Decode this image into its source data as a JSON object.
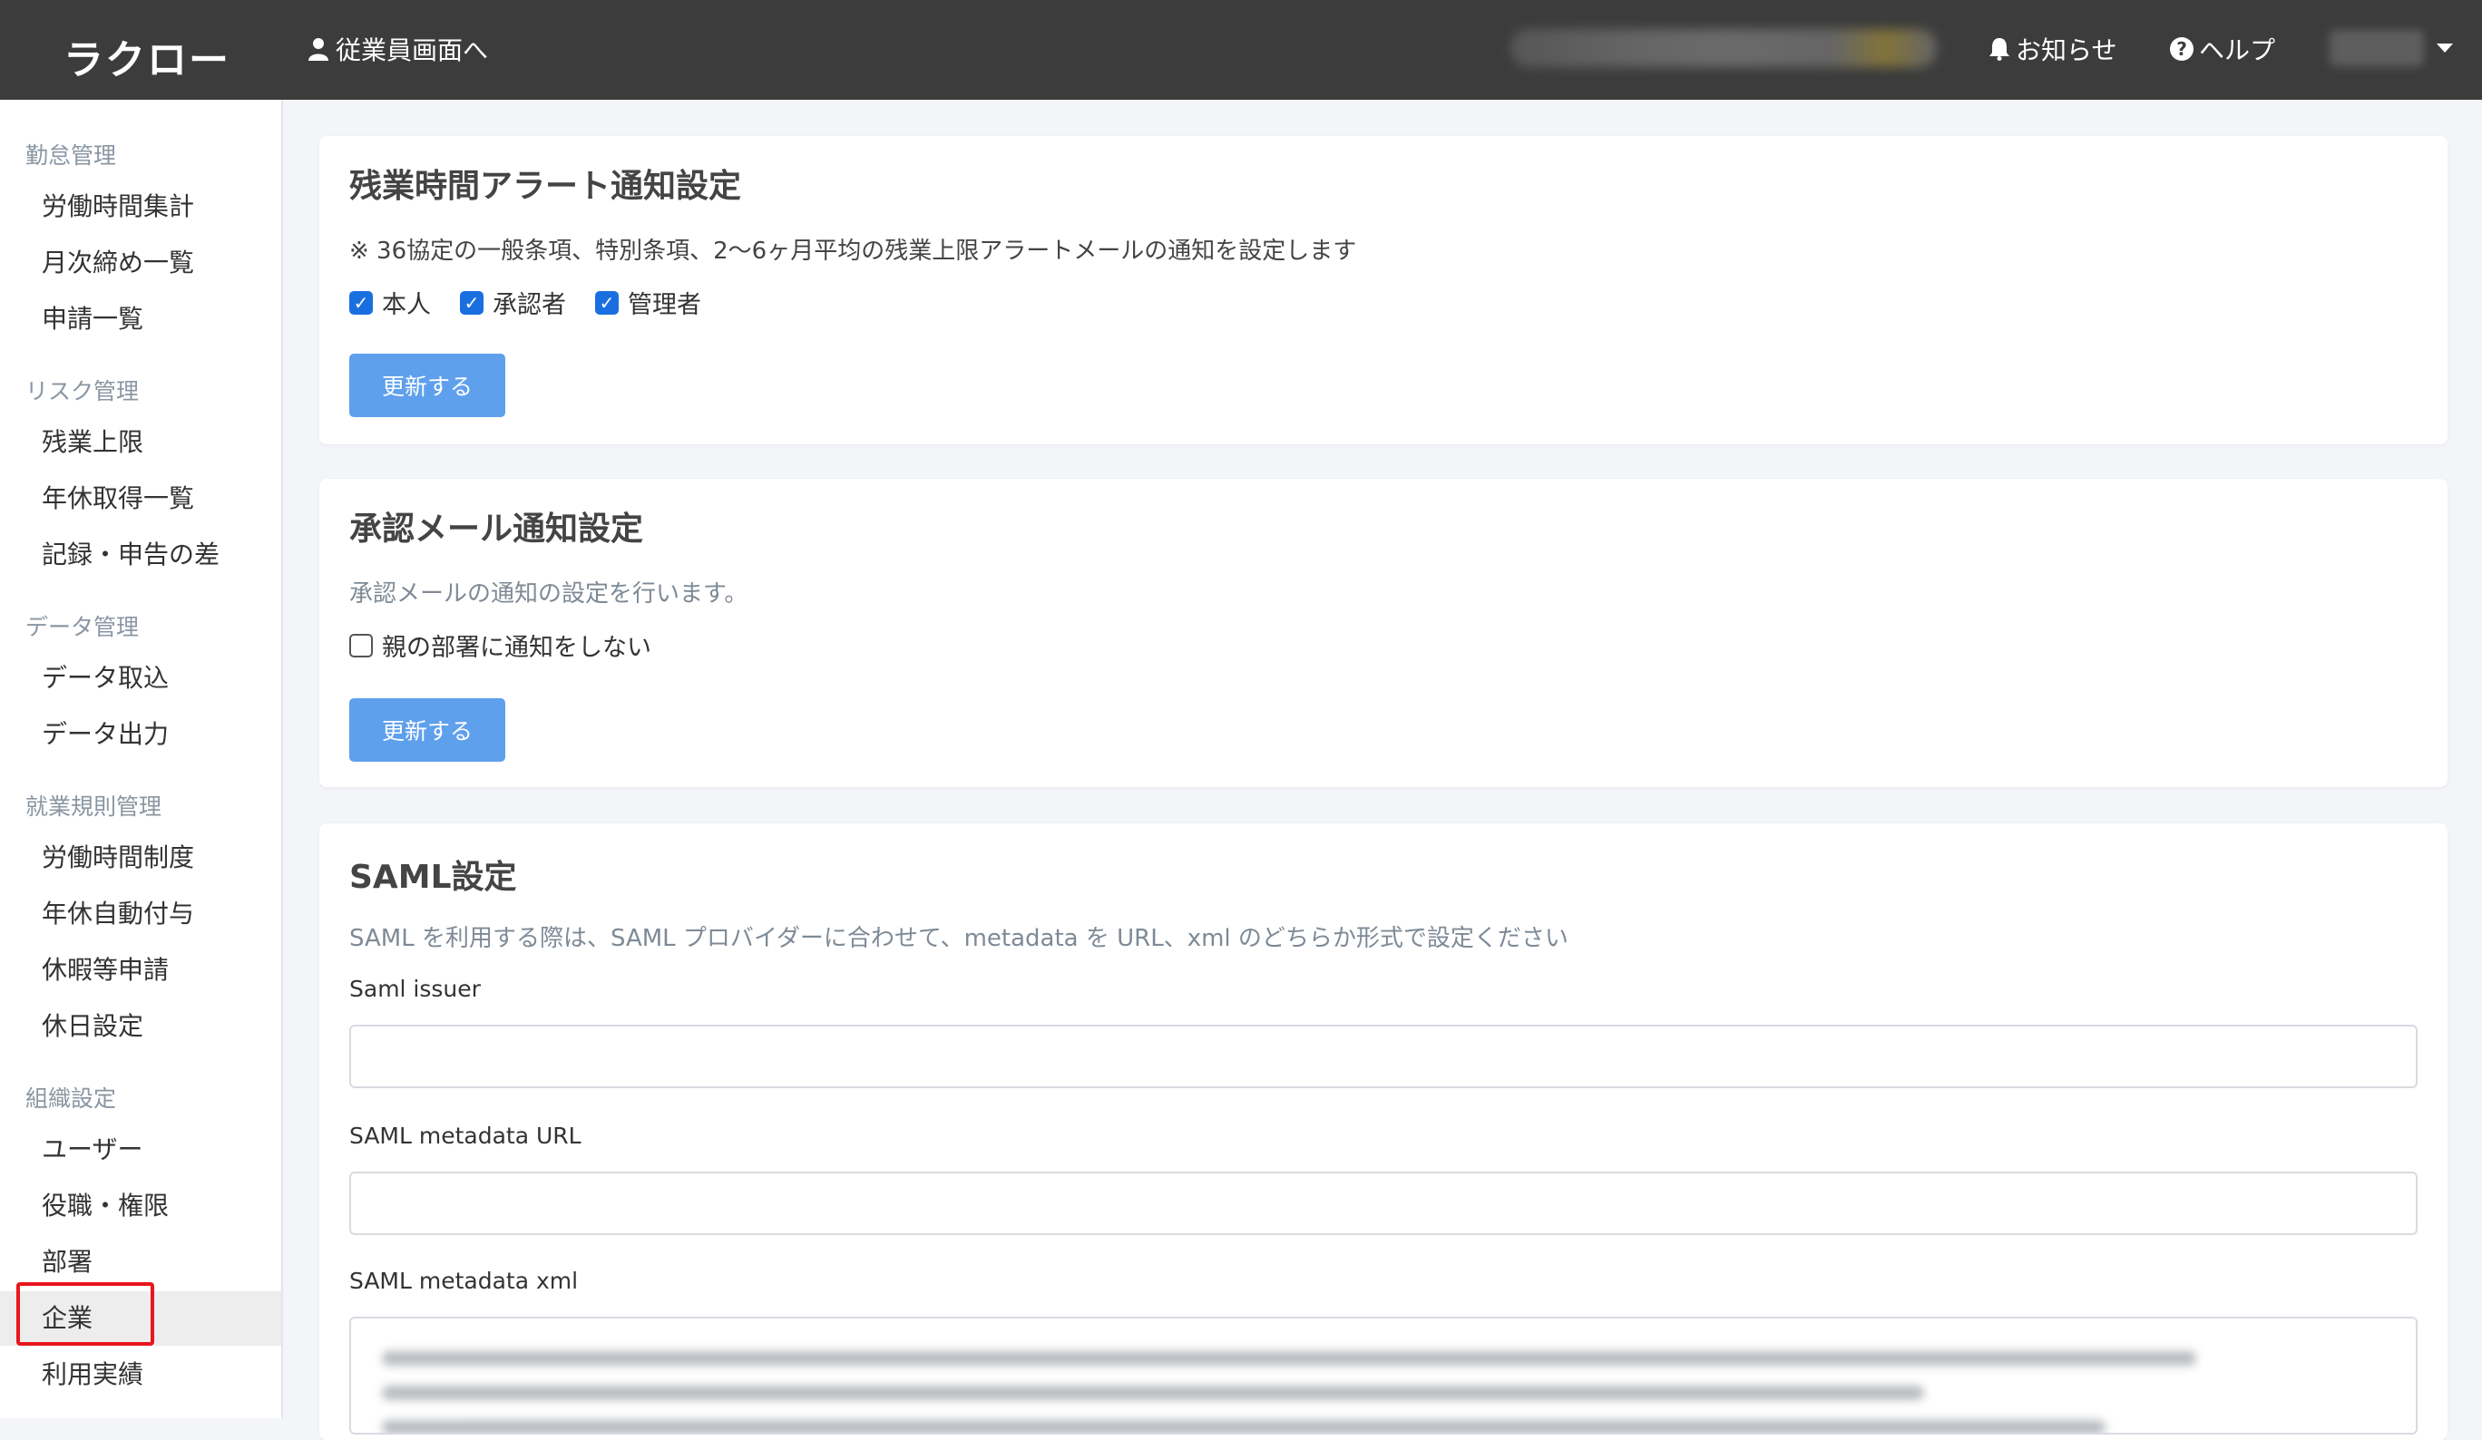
{
  "header": {
    "logo": "ラクロー",
    "employee_link": "従業員画面へ",
    "notice": "お知らせ",
    "help": "ヘルプ"
  },
  "sidebar": {
    "sections": [
      {
        "title": "勤怠管理",
        "items": [
          "労働時間集計",
          "月次締め一覧",
          "申請一覧"
        ]
      },
      {
        "title": "リスク管理",
        "items": [
          "残業上限",
          "年休取得一覧",
          "記録・申告の差"
        ]
      },
      {
        "title": "データ管理",
        "items": [
          "データ取込",
          "データ出力"
        ]
      },
      {
        "title": "就業規則管理",
        "items": [
          "労働時間制度",
          "年休自動付与",
          "休暇等申請",
          "休日設定"
        ]
      },
      {
        "title": "組織設定",
        "items": [
          "ユーザー",
          "役職・権限",
          "部署",
          "企業",
          "利用実績"
        ]
      }
    ],
    "active_item": "企業"
  },
  "overtime_alert": {
    "title": "残業時間アラート通知設定",
    "description": "※ 36協定の一般条項、特別条項、2〜6ヶ月平均の残業上限アラートメールの通知を設定します",
    "checkboxes": [
      {
        "label": "本人",
        "checked": true
      },
      {
        "label": "承認者",
        "checked": true
      },
      {
        "label": "管理者",
        "checked": true
      }
    ],
    "submit_label": "更新する"
  },
  "approval_mail": {
    "title": "承認メール通知設定",
    "description": "承認メールの通知の設定を行います。",
    "checkbox": {
      "label": "親の部署に通知をしない",
      "checked": false
    },
    "submit_label": "更新する"
  },
  "saml": {
    "title": "SAML設定",
    "description": "SAML を利用する際は、SAML プロバイダーに合わせて、metadata を URL、xml のどちらか形式で設定ください",
    "issuer_label": "Saml issuer",
    "issuer_value": "",
    "metadata_url_label": "SAML metadata URL",
    "metadata_url_value": "",
    "metadata_xml_label": "SAML metadata xml"
  }
}
